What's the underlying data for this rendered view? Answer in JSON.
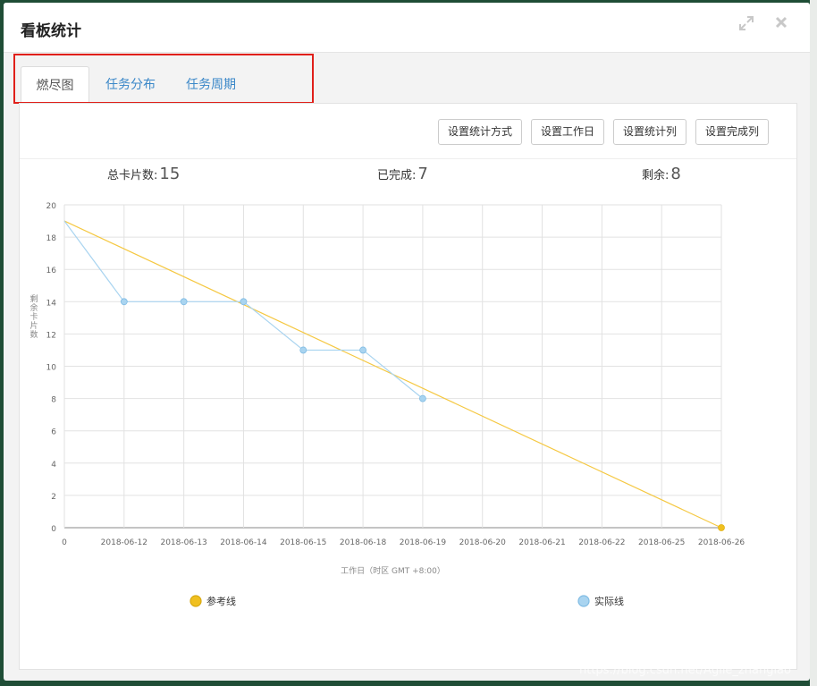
{
  "modal": {
    "title": "看板统计"
  },
  "header_icons": {
    "expand": "expand-icon",
    "close": "close-icon"
  },
  "tabs": [
    {
      "label": "燃尽图",
      "active": true
    },
    {
      "label": "任务分布",
      "active": false
    },
    {
      "label": "任务周期",
      "active": false
    }
  ],
  "toolbar": {
    "buttons": [
      "设置统计方式",
      "设置工作日",
      "设置统计列",
      "设置完成列"
    ]
  },
  "stats": {
    "total_label": "总卡片数:",
    "total_value": "15",
    "done_label": "已完成:",
    "done_value": "7",
    "remaining_label": "剩余:",
    "remaining_value": "8"
  },
  "chart_data": {
    "type": "line",
    "categories": [
      "0",
      "2018-06-12",
      "2018-06-13",
      "2018-06-14",
      "2018-06-15",
      "2018-06-18",
      "2018-06-19",
      "2018-06-20",
      "2018-06-21",
      "2018-06-22",
      "2018-06-25",
      "2018-06-26"
    ],
    "series": [
      {
        "name": "参考线",
        "color": "#f5c842",
        "values": [
          19,
          null,
          null,
          null,
          null,
          null,
          null,
          null,
          null,
          null,
          null,
          0
        ]
      },
      {
        "name": "实际线",
        "color": "#a9d4f0",
        "values": [
          19,
          14,
          14,
          14,
          11,
          11,
          8,
          null,
          null,
          null,
          null,
          null
        ]
      }
    ],
    "ylabel": "剩余卡片数",
    "xlabel": "工作日（时区 GMT +8:00）",
    "ylim": [
      0,
      20
    ],
    "yticks": [
      0,
      2,
      4,
      6,
      8,
      10,
      12,
      14,
      16,
      18,
      20
    ],
    "grid": true,
    "legend_position": "bottom"
  },
  "watermark": "https://blog.csdn.net/Agile_zhangiao"
}
